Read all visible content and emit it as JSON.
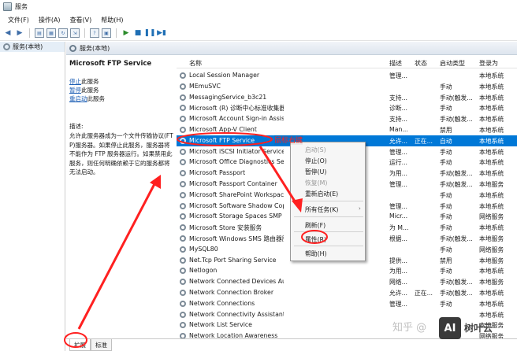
{
  "window": {
    "title": "服务"
  },
  "menu": [
    "文件(F)",
    "操作(A)",
    "查看(V)",
    "帮助(H)"
  ],
  "tree": {
    "root": "服务(本地)"
  },
  "pane": {
    "header": "服务(本地)"
  },
  "detail": {
    "title": "Microsoft FTP Service",
    "stop_link": "停止",
    "stop_suffix": "此服务",
    "pause_link": "暂停",
    "pause_suffix": "此服务",
    "restart_link": "重启动",
    "restart_suffix": "此服务",
    "desc_label": "描述:",
    "desc_text": "允许此服务器成为一个文件传输协议(FTP)服务器。如果停止此服务，服务器将不能作为 FTP 服务器运行。如果禁用此服务，则任何明确依赖于它的服务都将无法启动。"
  },
  "columns": {
    "name": "名称",
    "desc": "描述",
    "status": "状态",
    "startup": "启动类型",
    "logon": "登录为"
  },
  "rows": [
    {
      "name": "Local Session Manager",
      "desc": "管理...",
      "status": "",
      "startup": "",
      "logon": "本地系统"
    },
    {
      "name": "MEmuSVC",
      "desc": "",
      "status": "",
      "startup": "手动",
      "logon": "本地系统"
    },
    {
      "name": "MessagingService_b3c21",
      "desc": "支持...",
      "status": "",
      "startup": "手动(触发...",
      "logon": "本地系统"
    },
    {
      "name": "Microsoft (R) 诊断中心标准收集器服务",
      "desc": "诊断...",
      "status": "",
      "startup": "手动",
      "logon": "本地系统"
    },
    {
      "name": "Microsoft Account Sign-in Assistant",
      "desc": "支持...",
      "status": "",
      "startup": "手动(触发...",
      "logon": "本地系统"
    },
    {
      "name": "Microsoft App-V Client",
      "desc": "Man...",
      "status": "",
      "startup": "禁用",
      "logon": "本地系统"
    },
    {
      "name": "Microsoft FTP Service",
      "desc": "允许...",
      "status": "正在...",
      "startup": "自动",
      "logon": "本地系统"
    },
    {
      "name": "Microsoft iSCSI Initiator Service",
      "desc": "管理...",
      "status": "",
      "startup": "手动",
      "logon": "本地系统"
    },
    {
      "name": "Microsoft Office Diagnostics Service",
      "desc": "运行...",
      "status": "",
      "startup": "手动",
      "logon": "本地系统"
    },
    {
      "name": "Microsoft Passport",
      "desc": "为用...",
      "status": "",
      "startup": "手动(触发...",
      "logon": "本地系统"
    },
    {
      "name": "Microsoft Passport Container",
      "desc": "管理...",
      "status": "",
      "startup": "手动(触发...",
      "logon": "本地服务"
    },
    {
      "name": "Microsoft SharePoint Workspace Au",
      "desc": "",
      "status": "",
      "startup": "手动",
      "logon": "本地系统"
    },
    {
      "name": "Microsoft Software Shadow Copy P",
      "desc": "管理...",
      "status": "",
      "startup": "手动",
      "logon": "本地系统"
    },
    {
      "name": "Microsoft Storage Spaces SMP",
      "desc": "Micr...",
      "status": "",
      "startup": "手动",
      "logon": "网络服务"
    },
    {
      "name": "Microsoft Store 安装服务",
      "desc": "为 M...",
      "status": "",
      "startup": "手动",
      "logon": "本地系统"
    },
    {
      "name": "Microsoft Windows SMS 路由器服务",
      "desc": "根据...",
      "status": "",
      "startup": "手动(触发...",
      "logon": "本地服务"
    },
    {
      "name": "MySQL80",
      "desc": "",
      "status": "",
      "startup": "手动",
      "logon": "网络服务"
    },
    {
      "name": "Net.Tcp Port Sharing Service",
      "desc": "提供...",
      "status": "",
      "startup": "禁用",
      "logon": "本地服务"
    },
    {
      "name": "Netlogon",
      "desc": "为用...",
      "status": "",
      "startup": "手动",
      "logon": "本地系统"
    },
    {
      "name": "Network Connected Devices Auto-Setup",
      "desc": "网络...",
      "status": "",
      "startup": "手动(触发...",
      "logon": "本地服务"
    },
    {
      "name": "Network Connection Broker",
      "desc": "允许...",
      "status": "正在...",
      "startup": "手动(触发...",
      "logon": "本地系统"
    },
    {
      "name": "Network Connections",
      "desc": "管理...",
      "status": "",
      "startup": "手动",
      "logon": "本地系统"
    },
    {
      "name": "Network Connectivity Assistant",
      "desc": "",
      "status": "",
      "startup": "",
      "logon": "本地系统"
    },
    {
      "name": "Network List Service",
      "desc": "",
      "status": "",
      "startup": "",
      "logon": "本地服务"
    },
    {
      "name": "Network Location Awareness",
      "desc": "",
      "status": "",
      "startup": "",
      "logon": "网络服务"
    }
  ],
  "context_menu": {
    "start": "启动(S)",
    "stop": "停止(O)",
    "pause": "暂停(U)",
    "resume": "恢复(M)",
    "restart": "重新启动(E)",
    "all_tasks": "所有任务(K)",
    "all_tasks_arrow": "›",
    "refresh": "刷新(F)",
    "properties": "属性(R)",
    "help": "帮助(H)"
  },
  "annotation": {
    "label": "鼠标右键"
  },
  "tabs": {
    "extended": "扩展",
    "standard": "标准"
  },
  "watermark": {
    "text": "知乎 @",
    "logo": "AI",
    "brand": "树叶云"
  },
  "colors": {
    "selection": "#0078d7",
    "annotation": "#ff2020",
    "link": "#1d5fb5"
  }
}
